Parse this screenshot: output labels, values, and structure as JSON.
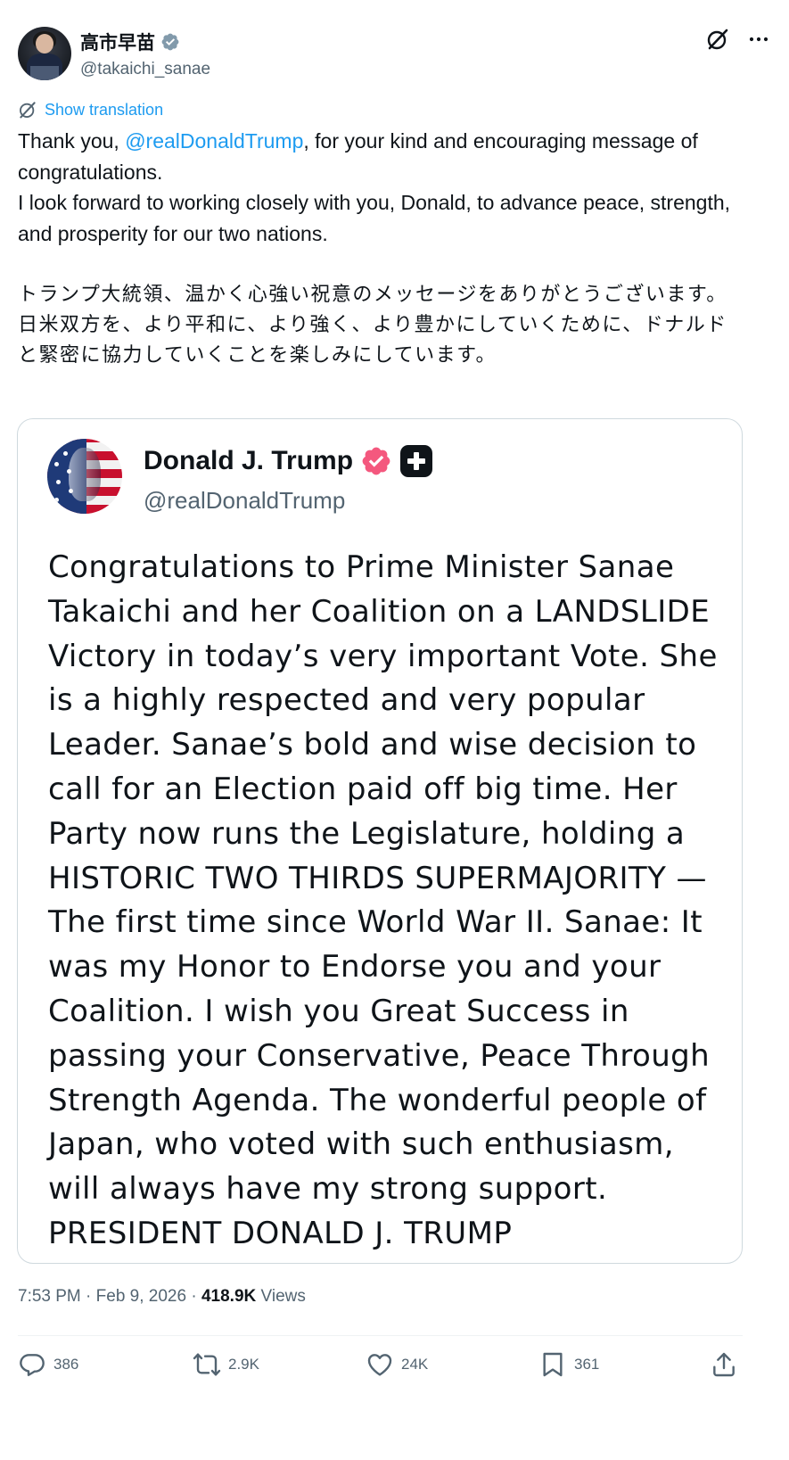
{
  "author": {
    "display_name": "高市早苗",
    "handle": "@takaichi_sanae"
  },
  "header_icons": [
    "grok-icon",
    "more-icon"
  ],
  "translation": {
    "label": "Show translation"
  },
  "tweet": {
    "line1_before": "Thank you, ",
    "line1_mention": "@realDonaldTrump",
    "line1_after": ", for your kind and encouraging message of congratulations.",
    "line2": "I look forward to working closely with you, Donald, to advance peace, strength, and prosperity for our two nations.",
    "jp1": "トランプ大統領、温かく心強い祝意のメッセージをありがとうございます。",
    "jp2": "日米双方を、より平和に、より強く、より豊かにしていくために、ドナルドと緊密に協力していくことを楽しみにしています。"
  },
  "quote": {
    "display_name": "Donald J. Trump",
    "handle": "@realDonaldTrump",
    "text": "Congratulations to Prime Minister Sanae Takaichi and her Coalition on a LANDSLIDE Victory in today’s very important Vote. She is a highly respected and very popular Leader. Sanae’s bold and wise decision to call for an Election paid off big time. Her Party now runs the Legislature, holding a HISTORIC TWO THIRDS SUPERMAJORITY — The first time since World War II. Sanae: It was my Honor to Endorse you and your Coalition. I wish you Great Success in passing your Conservative, Peace Through Strength Agenda. The wonderful people of Japan, who voted with such enthusiasm, will always have my strong support. PRESIDENT DONALD J. TRUMP",
    "badge_color": "#f4587e"
  },
  "meta": {
    "time": "7:53 PM",
    "sep1": " · ",
    "date": "Feb 9, 2026",
    "sep2": " · ",
    "views_count": "418.9K",
    "views_label": " Views"
  },
  "actions": {
    "replies": "386",
    "reposts": "2.9K",
    "likes": "24K",
    "bookmarks": "361"
  },
  "colors": {
    "link": "#1d9bf0",
    "secondary_text": "#536471",
    "border": "#cfd9de"
  }
}
